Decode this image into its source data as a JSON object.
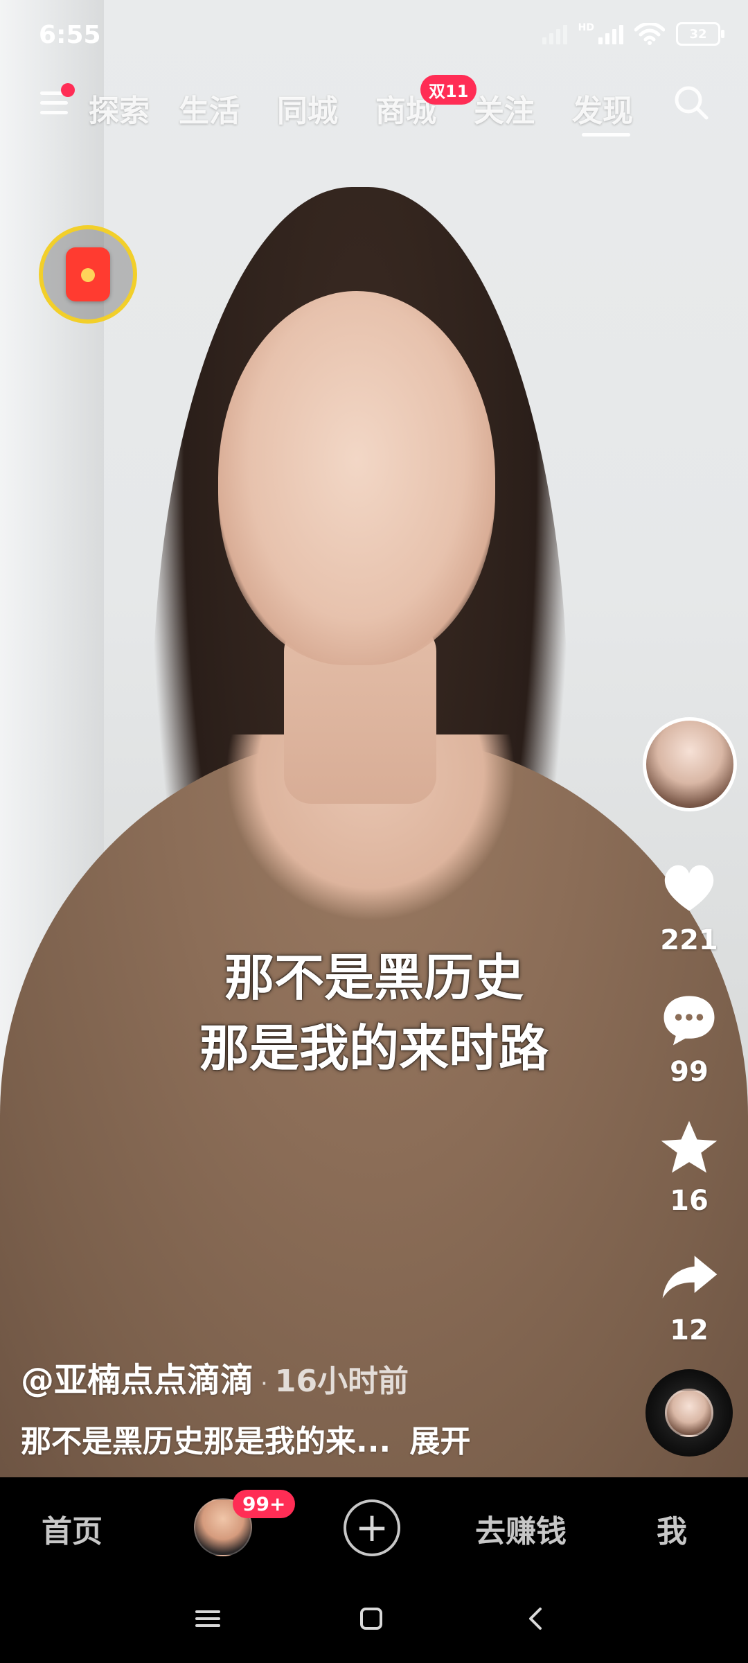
{
  "status_bar": {
    "time": "6:55",
    "hd": "HD",
    "battery": "32"
  },
  "top_nav": {
    "tabs": [
      "探索",
      "生活",
      "同城",
      "商城",
      "关注",
      "发现"
    ],
    "active_tab": "发现",
    "shop_badge": "双11"
  },
  "video": {
    "subtitle_line_1": "那不是黑历史",
    "subtitle_line_2": "那是我的来时路"
  },
  "right_rail": {
    "likes": "221",
    "comments": "99",
    "favorites": "16",
    "shares": "12",
    "icons": {
      "like": "heart-icon",
      "comment": "comment-icon",
      "favorite": "star-icon",
      "share": "share-icon"
    }
  },
  "caption": {
    "author": "@亚楠点点滴滴",
    "separator": "·",
    "time": "16小时前",
    "text": "那不是黑历史那是我的来...",
    "expand": "展开"
  },
  "bottom_tabs": {
    "home": "首页",
    "badge": "99+",
    "earn": "去赚钱",
    "me": "我"
  },
  "colors": {
    "accent_red": "#ff2d55",
    "ring_yellow": "#f2cf2a",
    "red_packet": "#ff3b30"
  }
}
